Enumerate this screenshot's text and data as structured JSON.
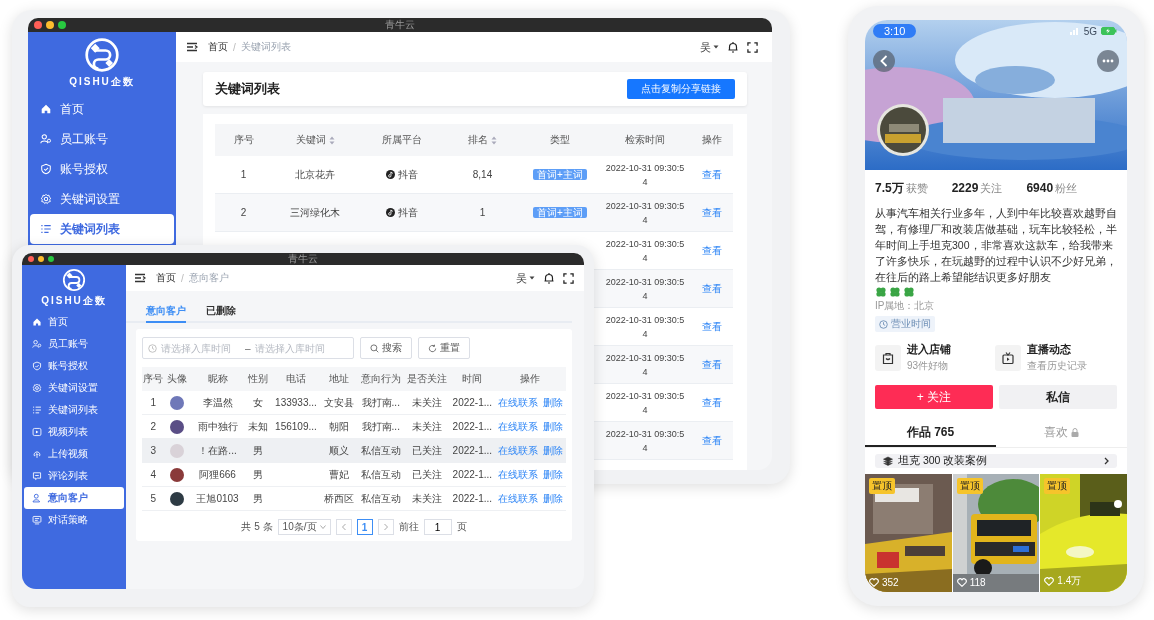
{
  "back_window": {
    "title": "青牛云",
    "logo_text": "QISHU企数",
    "sidebar": [
      {
        "label": "首页",
        "selected": false
      },
      {
        "label": "员工账号",
        "selected": false
      },
      {
        "label": "账号授权",
        "selected": false
      },
      {
        "label": "关键词设置",
        "selected": false
      },
      {
        "label": "关键词列表",
        "selected": true
      }
    ],
    "breadcrumb": [
      "首页",
      "关键词列表"
    ],
    "breadcrumb_separator": "/",
    "user": "吴",
    "page_title": "关键词列表",
    "share_button": "点击复制分享链接",
    "table": {
      "columns": [
        {
          "label": "序号",
          "sortable": false
        },
        {
          "label": "关键词",
          "sortable": true
        },
        {
          "label": "所属平台",
          "sortable": false
        },
        {
          "label": "排名",
          "sortable": true
        },
        {
          "label": "类型",
          "sortable": false
        },
        {
          "label": "检索时间",
          "sortable": false
        },
        {
          "label": "操作",
          "sortable": false
        }
      ],
      "rows": [
        {
          "index": "1",
          "keyword": "北京花卉",
          "platform": "抖音",
          "rank": "8,14",
          "type": "首词+主词",
          "time": "2022-10-31 09:30:54",
          "action": "查看"
        },
        {
          "index": "2",
          "keyword": "三河绿化木",
          "platform": "抖音",
          "rank": "1",
          "type": "首词+主词",
          "time": "2022-10-31 09:30:54",
          "action": "查看"
        },
        {
          "time": "2022-10-31 09:30:54",
          "action": "查看"
        },
        {
          "time": "2022-10-31 09:30:54",
          "action": "查看"
        },
        {
          "time": "2022-10-31 09:30:54",
          "action": "查看"
        },
        {
          "time": "2022-10-31 09:30:54",
          "action": "查看"
        },
        {
          "time": "2022-10-31 09:30:54",
          "action": "查看"
        },
        {
          "time": "2022-10-31 09:30:54",
          "action": "查看"
        }
      ]
    }
  },
  "front_window": {
    "title": "青牛云",
    "logo_text": "QISHU企数",
    "sidebar": [
      {
        "label": "首页",
        "selected": false
      },
      {
        "label": "员工账号",
        "selected": false
      },
      {
        "label": "账号授权",
        "selected": false
      },
      {
        "label": "关键词设置",
        "selected": false
      },
      {
        "label": "关键词列表",
        "selected": false
      },
      {
        "label": "视频列表",
        "selected": false
      },
      {
        "label": "上传视频",
        "selected": false
      },
      {
        "label": "评论列表",
        "selected": false
      },
      {
        "label": "意向客户",
        "selected": true
      },
      {
        "label": "对话策略",
        "selected": false
      }
    ],
    "breadcrumb": [
      "首页",
      "意向客户"
    ],
    "breadcrumb_separator": "/",
    "user": "吴",
    "tabs": [
      {
        "label": "意向客户",
        "selected": true
      },
      {
        "label": "已删除",
        "selected": false
      }
    ],
    "date_range": {
      "start_placeholder": "请选择入库时间",
      "separator": "–",
      "end_placeholder": "请选择入库时间"
    },
    "search_button": "搜索",
    "reset_button": "重置",
    "table": {
      "columns": [
        "序号",
        "头像",
        "昵称",
        "性别",
        "电话",
        "地址",
        "意向行为",
        "是否关注",
        "时间",
        "操作"
      ],
      "rows": [
        {
          "index": "1",
          "nickname": "李温然",
          "gender": "女",
          "phone": "133933...",
          "address": "文安县",
          "intent": "我打南...",
          "follow": "未关注",
          "time": "2022-1...",
          "actions": [
            "在线联系",
            "删除"
          ],
          "highlighted": false
        },
        {
          "index": "2",
          "nickname": "雨中独行",
          "gender": "未知",
          "phone": "156109...",
          "address": "朝阳",
          "intent": "我打南...",
          "follow": "未关注",
          "time": "2022-1...",
          "actions": [
            "在线联系",
            "删除"
          ],
          "highlighted": false
        },
        {
          "index": "3",
          "nickname": "！在路...",
          "gender": "男",
          "address": "顺义",
          "intent": "私信互动",
          "follow": "已关注",
          "time": "2022-1...",
          "actions": [
            "在线联系",
            "删除"
          ],
          "highlighted": true
        },
        {
          "index": "4",
          "nickname": "阿狸666",
          "gender": "男",
          "address": "曹妃",
          "intent": "私信互动",
          "follow": "已关注",
          "time": "2022-1...",
          "actions": [
            "在线联系",
            "删除"
          ],
          "highlighted": false
        },
        {
          "index": "5",
          "nickname": "王旭0103",
          "gender": "男",
          "address": "桥西区",
          "intent": "私信互动",
          "follow": "未关注",
          "time": "2022-1...",
          "actions": [
            "在线联系",
            "删除"
          ],
          "highlighted": false
        }
      ]
    },
    "pagination": {
      "total": "共 5 条",
      "page_size": "10条/页",
      "pages": [
        {
          "label": "1",
          "selected": true
        }
      ],
      "goto_label": "前往",
      "goto_value": "1",
      "goto_suffix": "页"
    }
  },
  "phone": {
    "status_time": "3:10",
    "network": "5G",
    "stats": [
      {
        "value": "7.5万",
        "label": "获赞"
      },
      {
        "value": "2229",
        "label": "关注"
      },
      {
        "value": "6940",
        "label": "粉丝"
      }
    ],
    "bio": "从事汽车相关行业多年，人到中年比较喜欢越野自驾，有修理厂和改装店做基础，玩车比较轻松，半年时间上手坦克300，非常喜欢这款车，给我带来了许多快乐，在玩越野的过程中认识不少好兄弟，在往后的路上希望能结识更多好朋友",
    "ip": "IP属地：北京",
    "hours_tag": "营业时间",
    "shortcuts": [
      {
        "title": "进入店铺",
        "subtitle": "93件好物"
      },
      {
        "title": "直播动态",
        "subtitle": "查看历史记录"
      }
    ],
    "follow_button": "+ 关注",
    "message_button": "私信",
    "tabs": [
      {
        "label": "作品 765",
        "selected": true,
        "locked": false
      },
      {
        "label": "喜欢",
        "selected": false,
        "locked": true
      }
    ],
    "collection": "坦克 300 改装案例",
    "videos": [
      {
        "badge": "置顶",
        "likes": "352"
      },
      {
        "badge": "置顶",
        "likes": "118"
      },
      {
        "badge": "置顶",
        "likes": "1.4万"
      }
    ]
  }
}
